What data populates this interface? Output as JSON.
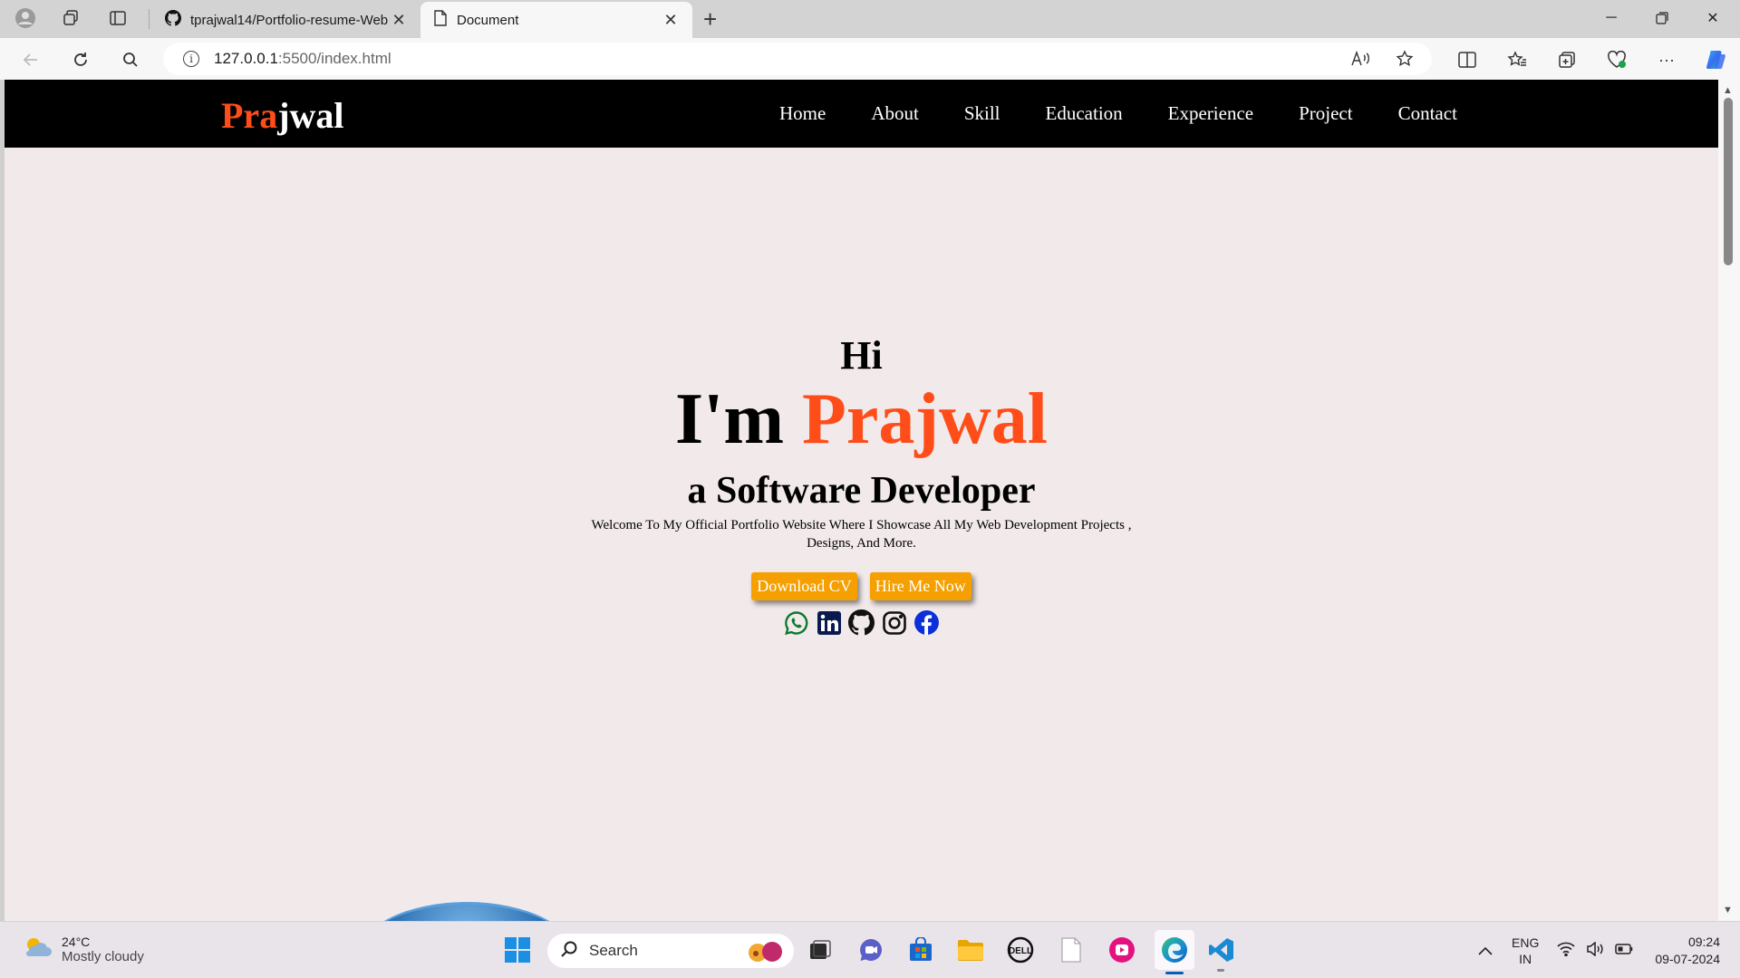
{
  "browser": {
    "tabs": [
      {
        "title": "tprajwal14/Portfolio-resume-Web",
        "active": false
      },
      {
        "title": "Document",
        "active": true
      }
    ],
    "url_host": "127.0.0.1",
    "url_rest": ":5500/index.html"
  },
  "site": {
    "logo_accent": "Pra",
    "logo_rest": "jwal",
    "nav": [
      "Home",
      "About",
      "Skill",
      "Education",
      "Experience",
      "Project",
      "Contact"
    ],
    "hero": {
      "hi": "Hi",
      "im": "I'm",
      "name": "Prajwal",
      "role": "a Software Developer",
      "description": "Welcome To My Official Portfolio Website Where I Showcase All My Web Development Projects , Designs, And More.",
      "download_cv": "Download CV",
      "hire_me": "Hire Me Now"
    },
    "socials": [
      "whatsapp-icon",
      "linkedin-icon",
      "github-icon",
      "instagram-icon",
      "facebook-icon"
    ],
    "colors": {
      "accent": "#ff4d1a",
      "button": "#f5a000",
      "background": "#f2eaea",
      "navbar": "#000000"
    }
  },
  "taskbar": {
    "temperature": "24°C",
    "weather": "Mostly cloudy",
    "search_placeholder": "Search",
    "lang_top": "ENG",
    "lang_bottom": "IN",
    "time": "09:24",
    "date": "09-07-2024"
  }
}
